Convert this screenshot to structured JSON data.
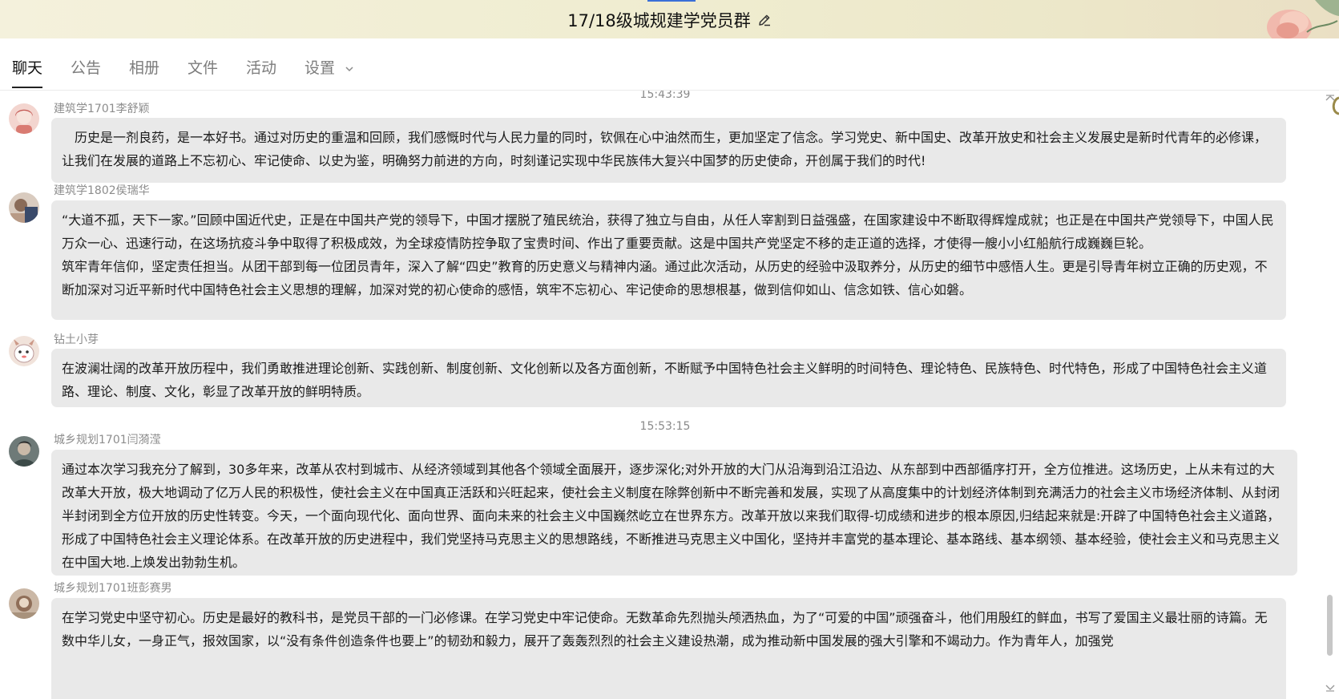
{
  "window": {
    "title": "17/18级城规建学党员群"
  },
  "tabs": [
    {
      "label": "聊天",
      "active": true
    },
    {
      "label": "公告",
      "active": false
    },
    {
      "label": "相册",
      "active": false
    },
    {
      "label": "文件",
      "active": false
    },
    {
      "label": "活动",
      "active": false
    },
    {
      "label": "设置",
      "active": false
    }
  ],
  "timestamps": [
    "15:43:39",
    "15:53:15"
  ],
  "messages": [
    {
      "sender": "建筑学1701李舒颖",
      "paragraphs": [
        "历史是一剂良药，是一本好书。通过对历史的重温和回顾，我们感慨时代与人民力量的同时，钦佩在心中油然而生，更加坚定了信念。学习党史、新中国史、改革开放史和社会主义发展史是新时代青年的必修课，让我们在发展的道路上不忘初心、牢记使命、以史为鉴，明确努力前进的方向，时刻谨记实现中华民族伟大复兴中国梦的历史使命，开创属于我们的时代!"
      ]
    },
    {
      "sender": "建筑学1802侯瑞华",
      "paragraphs": [
        "“大道不孤，天下一家。”回顾中国近代史，正是在中国共产党的领导下，中国才摆脱了殖民统治，获得了独立与自由，从任人宰割到日益强盛，在国家建设中不断取得辉煌成就；也正是在中国共产党领导下，中国人民万众一心、迅速行动，在这场抗疫斗争中取得了积极成效，为全球疫情防控争取了宝贵时间、作出了重要贡献。这是中国共产党坚定不移的走正道的选择，才使得一艘小小红船航行成巍巍巨轮。",
        "筑牢青年信仰，坚定责任担当。从团干部到每一位团员青年，深入了解“四史”教育的历史意义与精神内涵。通过此次活动，从历史的经验中汲取养分，从历史的细节中感悟人生。更是引导青年树立正确的历史观，不断加深对习近平新时代中国特色社会主义思想的理解，加深对党的初心使命的感悟，筑牢不忘初心、牢记使命的思想根基，做到信仰如山、信念如铁、信心如磐。"
      ]
    },
    {
      "sender": "钻土小芽",
      "paragraphs": [
        "在波澜壮阔的改革开放历程中，我们勇敢推进理论创新、实践创新、制度创新、文化创新以及各方面创新，不断赋予中国特色社会主义鲜明的时间特色、理论特色、民族特色、时代特色，形成了中国特色社会主义道路、理论、制度、文化，彰显了改革开放的鲜明特质。"
      ]
    },
    {
      "sender": "城乡规划1701闫漪滢",
      "paragraphs": [
        "通过本次学习我充分了解到，30多年来，改革从农村到城市、从经济领域到其他各个领域全面展开，逐步深化;对外开放的大门从沿海到沿江沿边、从东部到中西部循序打开，全方位推进。这场历史，上从未有过的大改革大开放，极大地调动了亿万人民的积极性，使社会主义在中国真正活跃和兴旺起来，使社会主义制度在除弊创新中不断完善和发展，实现了从高度集中的计划经济体制到充满活力的社会主义市场经济体制、从封闭半封闭到全方位开放的历史性转变。今天，一个面向现代化、面向世界、面向未来的社会主义中国巍然屹立在世界东方。改革开放以来我们取得-切成绩和进步的根本原因,归结起来就是:开辟了中国特色社会主义道路，形成了中国特色社会主义理论体系。在改革开放的历史进程中，我们党坚持马克思主义的思想路线，不断推进马克思主义中国化，坚持并丰富党的基本理论、基本路线、基本纲领、基本经验，使社会主义和马克思主义在中国大地.上焕发出勃勃生机。"
      ]
    },
    {
      "sender": "城乡规划1701班彭赛男",
      "paragraphs": [
        "在学习党史中坚守初心。历史是最好的教科书，是党员干部的一门必修课。在学习党史中牢记使命。无数革命先烈抛头颅洒热血，为了“可爱的中国”顽强奋斗，他们用殷红的鲜血，书写了爱国主义最壮丽的诗篇。无数中华儿女，一身正气，报效国家，以“没有条件创造条件也要上”的韧劲和毅力，展开了轰轰烈烈的社会主义建设热潮，成为推动新中国发展的强大引擎和不竭动力。作为青年人，加强党"
      ]
    }
  ],
  "icons": {
    "edit": "pencil-icon",
    "dropdown": "chevron-down-icon",
    "phone": "phone-icon"
  },
  "colors": {
    "titlebar_bg": "#efeccf",
    "bubble_bg": "#e9e9e9",
    "tab_active": "#111111",
    "tab_inactive": "#7c7c7c"
  }
}
